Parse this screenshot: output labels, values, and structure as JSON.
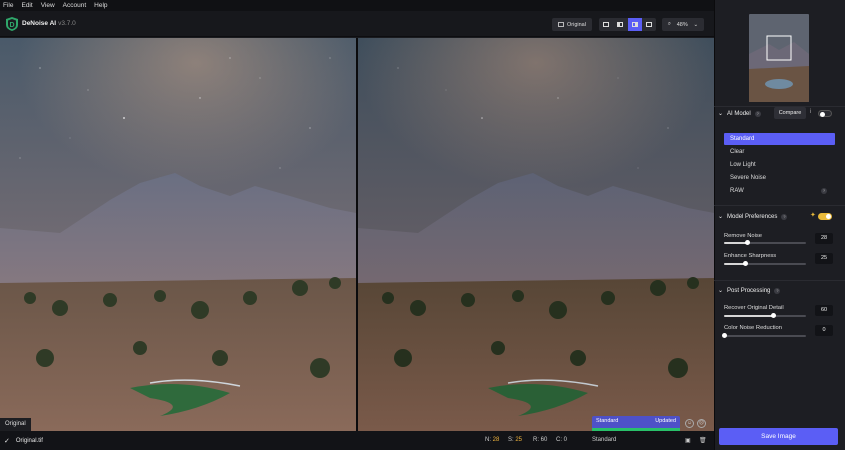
{
  "menu": [
    "File",
    "Edit",
    "View",
    "Account",
    "Help"
  ],
  "app": {
    "name": "DeNoise AI",
    "version": "v3.7.0"
  },
  "toolbar": {
    "original_label": "Original",
    "zoom": "48%",
    "views": [
      "single",
      "split",
      "side-by-side",
      "grid"
    ],
    "active_view": 2
  },
  "preview": {
    "left_label": "Original",
    "model_chip": {
      "model": "Standard",
      "status": "Updated"
    }
  },
  "status": {
    "file": "Original.tif",
    "n_label": "N:",
    "n": "28",
    "s_label": "S:",
    "s": "25",
    "r_label": "R:",
    "r": "60",
    "c_label": "C:",
    "c": "0",
    "model": "Standard"
  },
  "sidebar": {
    "ai_model": {
      "title": "AI Model",
      "compare": "Compare",
      "items": [
        "Standard",
        "Clear",
        "Low Light",
        "Severe Noise",
        "RAW"
      ],
      "selected": 0
    },
    "model_prefs": {
      "title": "Model Preferences",
      "sliders": [
        {
          "label": "Remove Noise",
          "value": "28",
          "fraction": 0.28
        },
        {
          "label": "Enhance Sharpness",
          "value": "25",
          "fraction": 0.25
        }
      ]
    },
    "post": {
      "title": "Post Processing",
      "sliders": [
        {
          "label": "Recover Original Detail",
          "value": "60",
          "fraction": 0.6
        },
        {
          "label": "Color Noise Reduction",
          "value": "0",
          "fraction": 0
        }
      ]
    },
    "save": "Save Image"
  },
  "colors": {
    "accent": "#5b5ef5",
    "toggle_on": "#e8b93a",
    "value_highlight": "#f0b43c",
    "updated_bar": "#29c06a"
  }
}
